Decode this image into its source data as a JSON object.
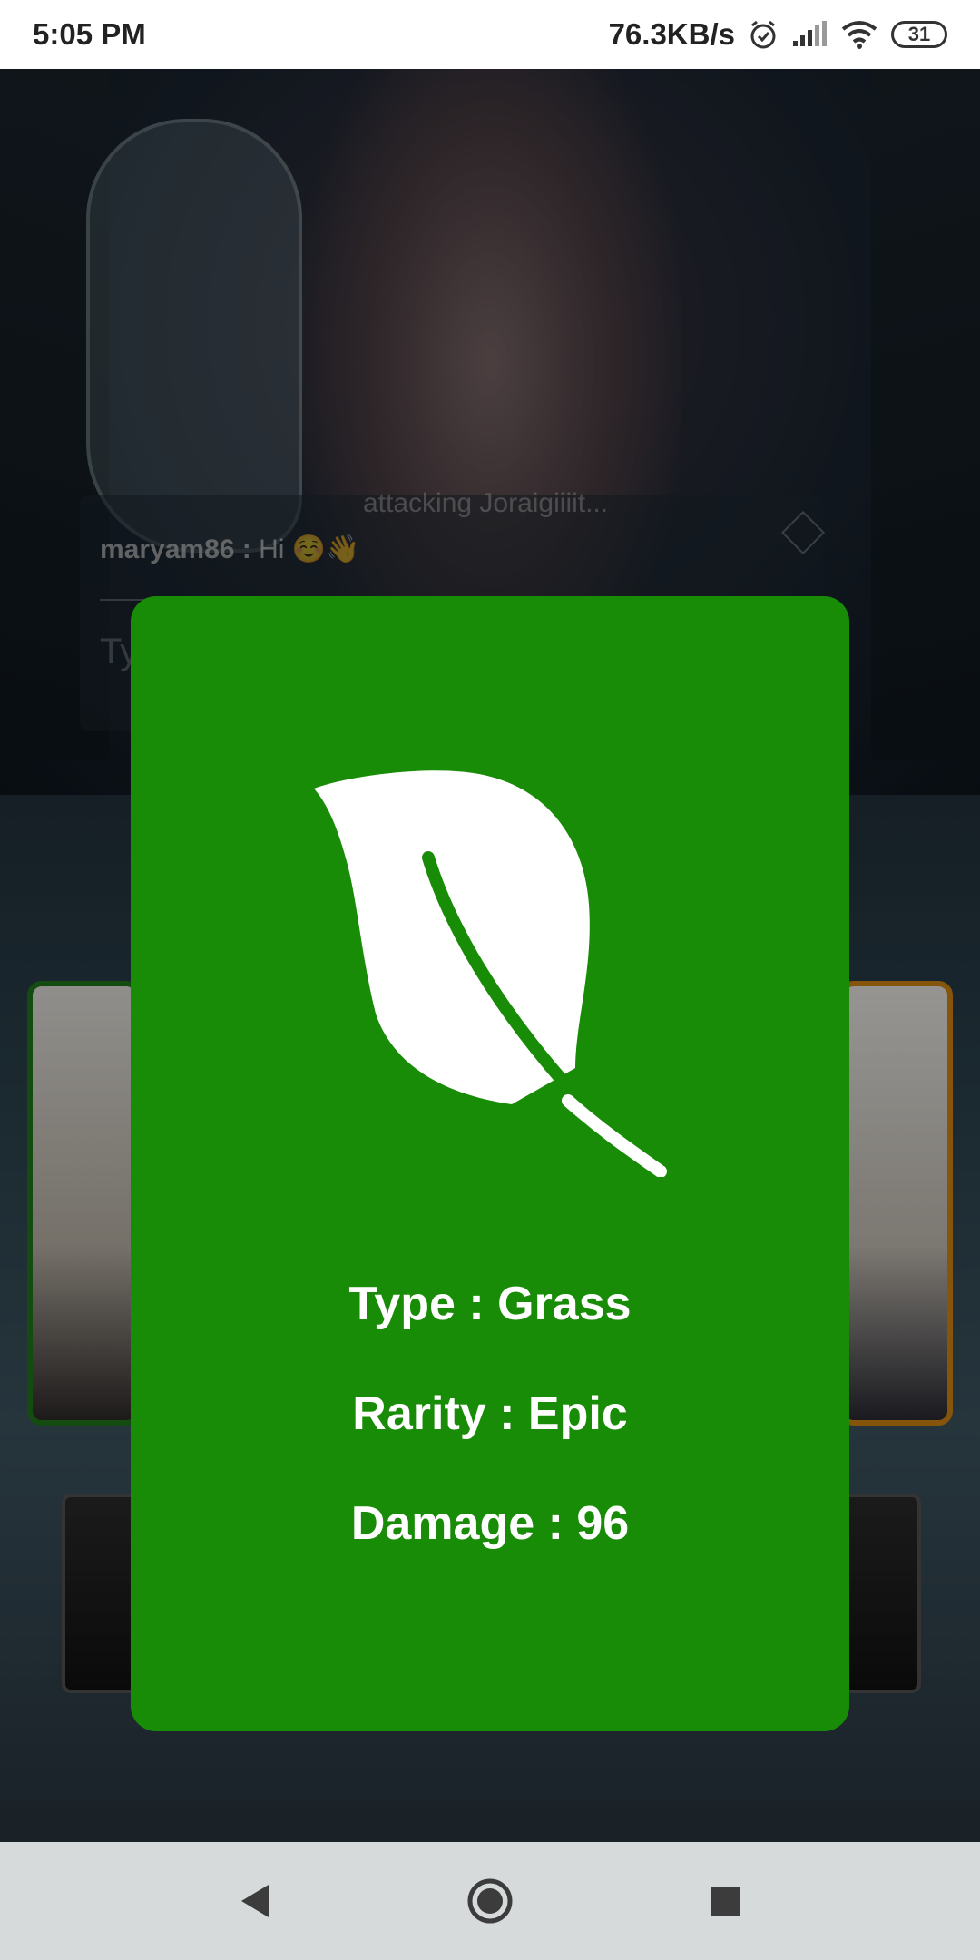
{
  "status_bar": {
    "time": "5:05 PM",
    "network_speed": "76.3KB/s",
    "battery_level": "31",
    "icons": [
      "alarm-icon",
      "signal-icon",
      "wifi-icon",
      "battery-icon"
    ]
  },
  "background": {
    "chat": {
      "faded_message": "attacking  Joraigiiiit...",
      "username": "maryam86 :",
      "message": "Hi ☺️👋",
      "input_placeholder": "Ty"
    }
  },
  "card_modal": {
    "icon": "leaf-icon",
    "background_color": "#188c06",
    "type_text": "Type : Grass",
    "rarity_text": "Rarity : Epic",
    "damage_text": "Damage : 96"
  },
  "nav_bar": {
    "icons": [
      "back-icon",
      "home-icon",
      "recents-icon"
    ]
  }
}
